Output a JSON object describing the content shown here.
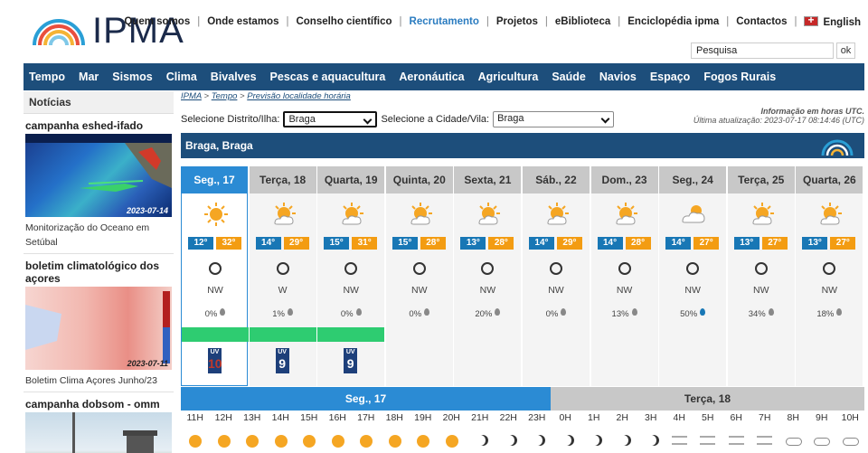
{
  "brand": "IPMA",
  "toplinks": [
    "Quem somos",
    "Onde estamos",
    "Conselho científico",
    "Recrutamento",
    "Projetos",
    "eBiblioteca",
    "Enciclopédia ipma",
    "Contactos",
    "English"
  ],
  "search": {
    "placeholder": "Pesquisa",
    "button": "ok"
  },
  "nav": [
    "Tempo",
    "Mar",
    "Sismos",
    "Clima",
    "Bivalves",
    "Pescas e aquacultura",
    "Aeronáutica",
    "Agricultura",
    "Saúde",
    "Navios",
    "Espaço",
    "Fogos Rurais"
  ],
  "sidebar": {
    "title": "Notícias",
    "items": [
      {
        "heading": "campanha eshed-ifado",
        "date": "2023-07-14",
        "caption": "Monitorização do Oceano em Setúbal"
      },
      {
        "heading": "boletim climatológico dos açores",
        "date": "2023-07-11",
        "caption": "Boletim Clima Açores Junho/23"
      },
      {
        "heading": "campanha dobsom - omm",
        "date": "",
        "caption": ""
      }
    ]
  },
  "breadcrumb": {
    "a": "IPMA",
    "b": "Tempo",
    "c": "Previsão localidade horária"
  },
  "info": {
    "line1": "Informação em horas UTC.",
    "line2": "Última atualização: 2023-07-17 08:14:46 (UTC)"
  },
  "selects": {
    "district_label": "Selecione Distrito/Ilha:",
    "district_value": "Braga",
    "city_label": "Selecione a Cidade/Vila:",
    "city_value": "Braga"
  },
  "location": "Braga, Braga",
  "days": [
    {
      "name": "Seg., 17",
      "min": "12°",
      "max": "32°",
      "wind": "NW",
      "prec": "0%",
      "icon": "sun-icon",
      "uv": "10"
    },
    {
      "name": "Terça, 18",
      "min": "14°",
      "max": "29°",
      "wind": "W",
      "prec": "1%",
      "icon": "sun-cloud-icon",
      "uv": "9"
    },
    {
      "name": "Quarta, 19",
      "min": "15°",
      "max": "31°",
      "wind": "NW",
      "prec": "0%",
      "icon": "sun-cloud-icon",
      "uv": "9"
    },
    {
      "name": "Quinta, 20",
      "min": "15°",
      "max": "28°",
      "wind": "NW",
      "prec": "0%",
      "icon": "sun-cloud-icon",
      "uv": ""
    },
    {
      "name": "Sexta, 21",
      "min": "13°",
      "max": "28°",
      "wind": "NW",
      "prec": "20%",
      "icon": "sun-cloud-icon",
      "uv": ""
    },
    {
      "name": "Sáb., 22",
      "min": "14°",
      "max": "29°",
      "wind": "NW",
      "prec": "0%",
      "icon": "sun-cloud-icon",
      "uv": ""
    },
    {
      "name": "Dom., 23",
      "min": "14°",
      "max": "28°",
      "wind": "NW",
      "prec": "13%",
      "icon": "sun-cloud-icon",
      "uv": ""
    },
    {
      "name": "Seg., 24",
      "min": "14°",
      "max": "27°",
      "wind": "NW",
      "prec": "50%",
      "icon": "cloud-icon",
      "uv": ""
    },
    {
      "name": "Terça, 25",
      "min": "13°",
      "max": "27°",
      "wind": "NW",
      "prec": "34%",
      "icon": "sun-cloud-icon",
      "uv": ""
    },
    {
      "name": "Quarta, 26",
      "min": "13°",
      "max": "27°",
      "wind": "NW",
      "prec": "18%",
      "icon": "sun-cloud-icon",
      "uv": ""
    }
  ],
  "hourly": {
    "day1": "Seg., 17",
    "day2": "Terça, 18",
    "hours": [
      "11H",
      "12H",
      "13H",
      "14H",
      "15H",
      "16H",
      "17H",
      "18H",
      "19H",
      "20H",
      "21H",
      "22H",
      "23H",
      "0H",
      "1H",
      "2H",
      "3H",
      "4H",
      "5H",
      "6H",
      "7H",
      "8H",
      "9H",
      "10H"
    ],
    "icons": [
      "sun",
      "sun",
      "sun",
      "sun",
      "sun",
      "sun",
      "sun",
      "sun",
      "sun",
      "sun",
      "moon",
      "moon",
      "moon",
      "moon",
      "moon",
      "moon",
      "moon",
      "fog",
      "fog",
      "fog",
      "fog",
      "cloud",
      "cloud",
      "cloud"
    ]
  }
}
